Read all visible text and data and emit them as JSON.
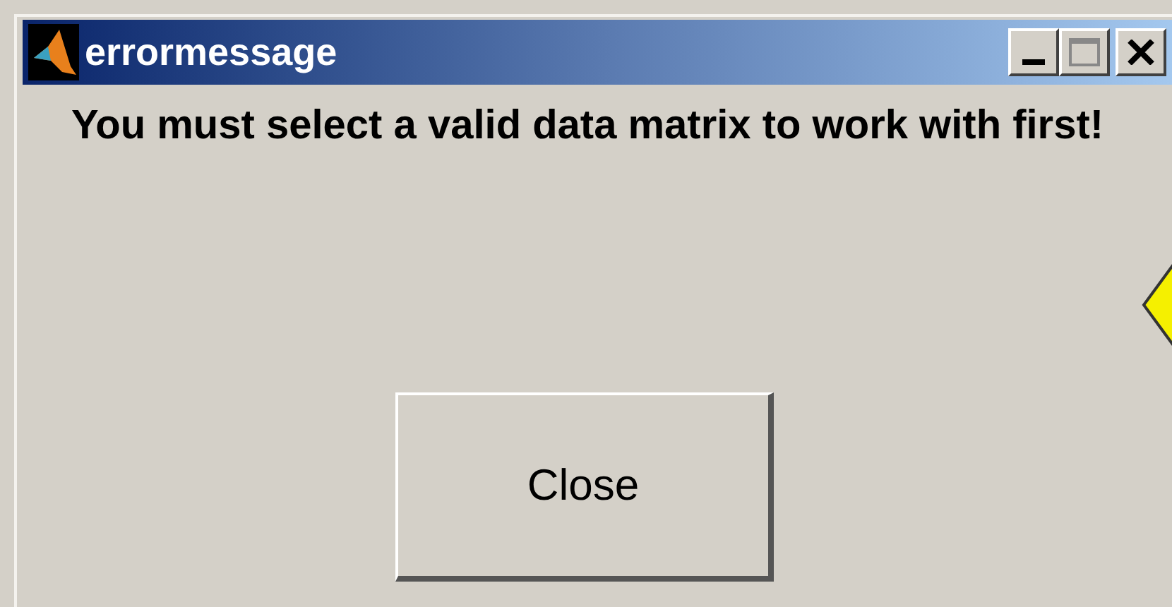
{
  "window": {
    "title": "errormessage"
  },
  "message": "You must select a valid data matrix to work with first!",
  "buttons": [
    "Close"
  ]
}
